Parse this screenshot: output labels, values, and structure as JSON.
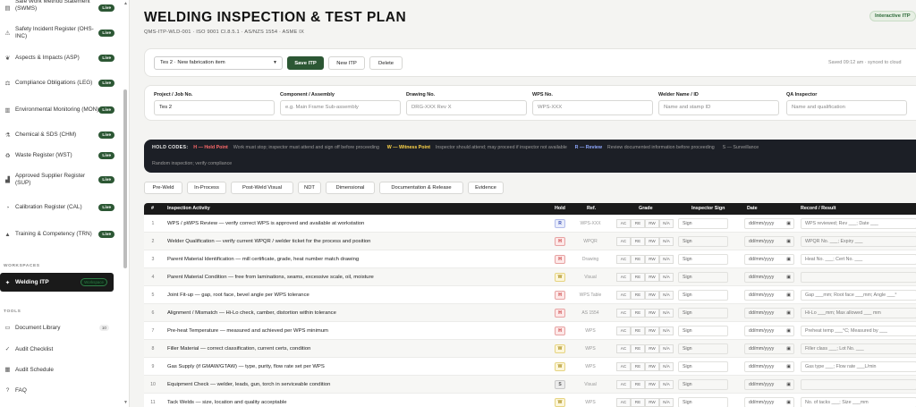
{
  "sidebar": {
    "items": [
      {
        "label": "Safe Work Method Statement (SWMS)",
        "status": "Live",
        "icon": "document-icon"
      },
      {
        "label": "Safety Incident Register (OHS-INC)",
        "status": "Live",
        "icon": "alert-icon"
      },
      {
        "label": "Aspects & Impacts (ASP)",
        "status": "Live",
        "icon": "leaf-icon"
      },
      {
        "label": "Compliance Obligations (LEG)",
        "status": "Live",
        "icon": "scale-icon"
      },
      {
        "label": "Environmental Monitoring (MON)",
        "status": "Live",
        "icon": "chart-icon"
      },
      {
        "label": "Chemical & SDS (CHM)",
        "status": "Live",
        "icon": "flask-icon"
      },
      {
        "label": "Waste Register (WST)",
        "status": "Live",
        "icon": "recycle-icon"
      },
      {
        "label": "Approved Supplier Register (SUP)",
        "status": "Live",
        "icon": "factory-icon"
      },
      {
        "label": "Calibration Register (CAL)",
        "status": "Live",
        "icon": "gauge-icon"
      },
      {
        "label": "Training & Competency (TRN)",
        "status": "Live",
        "icon": "graduation-icon"
      }
    ],
    "workspaces_label": "WORKSPACES",
    "active": {
      "label": "Welding ITP",
      "badge": "Workspace"
    },
    "tools_label": "TOOLS",
    "tools": [
      {
        "label": "Document Library",
        "count": "10",
        "icon": "book-icon"
      },
      {
        "label": "Audit Checklist",
        "icon": "check-icon"
      },
      {
        "label": "Audit Schedule",
        "icon": "calendar-icon"
      },
      {
        "label": "FAQ",
        "icon": "question-icon"
      }
    ]
  },
  "header": {
    "title": "WELDING INSPECTION & TEST PLAN",
    "subtitle": "QMS-ITP-WLD-001 · ISO 9001 Cl.8.5.1 · AS/NZS 1554 · ASME IX",
    "badge": "Interactive ITP"
  },
  "toolbar": {
    "selected_itp": "Tes 2 · New fabrication item",
    "save_label": "Save ITP",
    "new_label": "New ITP",
    "delete_label": "Delete",
    "saved_text": "Saved 09:12 am · synced to cloud"
  },
  "fields": [
    {
      "label": "Project / Job No.",
      "value": "Tes 2",
      "placeholder": ""
    },
    {
      "label": "Component / Assembly",
      "value": "",
      "placeholder": "e.g. Main Frame Sub-assembly"
    },
    {
      "label": "Drawing No.",
      "value": "",
      "placeholder": "DRG-XXX Rev X"
    },
    {
      "label": "WPS No.",
      "value": "",
      "placeholder": "WPS-XXX"
    },
    {
      "label": "Welder Name / ID",
      "value": "",
      "placeholder": "Name and stamp ID"
    },
    {
      "label": "QA Inspector",
      "value": "",
      "placeholder": "Name and qualification"
    }
  ],
  "hold_codes": {
    "heading": "HOLD CODES:",
    "hold_label": "H — Hold Point",
    "hold_desc": "Work must stop; inspector must attend and sign off before proceeding",
    "witness_label": "W — Witness Point",
    "witness_desc": "Inspector should attend; may proceed if inspector not available",
    "review_label": "R — Review",
    "review_desc": "Review documented information before proceeding",
    "surv_label": "S — Surveillance",
    "surv_desc": "Random inspection; verify compliance"
  },
  "filters": [
    "Pre-Weld",
    "In-Process",
    "Post-Weld Visual",
    "NDT",
    "Dimensional",
    "Documentation & Release",
    "Evidence"
  ],
  "table": {
    "headers": {
      "num": "#",
      "activity": "Inspection Activity",
      "hold": "Hold",
      "ref": "Ref.",
      "grade": "Grade",
      "sign": "Inspector Sign",
      "date": "Date",
      "record": "Record / Result"
    },
    "grade_options": [
      "AC",
      "RE",
      "RW",
      "N/A"
    ],
    "sign_placeholder": "Sign",
    "date_placeholder": "dd/mm/yyyy",
    "rows": [
      {
        "num": "1",
        "activity": "WPS / pWPS Review — verify correct WPS is approved and available at workstation",
        "hold": "R",
        "ref": "WPS-XXX",
        "record": "WPS reviewed; Rev ___; Date ___"
      },
      {
        "num": "2",
        "activity": "Welder Qualification — verify current WPQR / welder ticket for the process and position",
        "hold": "H",
        "ref": "WPQR",
        "record": "WPQR No. ___; Expiry ___"
      },
      {
        "num": "3",
        "activity": "Parent Material Identification — mill certificate, grade, heat number match drawing",
        "hold": "H",
        "ref": "Drawing",
        "record": "Heat No. ___; Cert No. ___"
      },
      {
        "num": "4",
        "activity": "Parent Material Condition — free from laminations, seams, excessive scale, oil, moisture",
        "hold": "W",
        "ref": "Visual",
        "record": ""
      },
      {
        "num": "5",
        "activity": "Joint Fit-up — gap, root face, bevel angle per WPS tolerance",
        "hold": "H",
        "ref": "WPS Table",
        "record": "Gap ___mm; Root face ___mm; Angle ___°"
      },
      {
        "num": "6",
        "activity": "Alignment / Mismatch — Hi-Lo check, camber, distortion within tolerance",
        "hold": "H",
        "ref": "AS 1554",
        "record": "Hi-Lo ___mm; Max allowed ___ mm"
      },
      {
        "num": "7",
        "activity": "Pre-heat Temperature — measured and achieved per WPS minimum",
        "hold": "H",
        "ref": "WPS",
        "record": "Preheat temp ___°C; Measured by ___"
      },
      {
        "num": "8",
        "activity": "Filler Material — correct classification, current certs, condition",
        "hold": "W",
        "ref": "WPS",
        "record": "Filler class ___; Lot No. ___"
      },
      {
        "num": "9",
        "activity": "Gas Supply (if GMAW/GTAW) — type, purity, flow rate set per WPS",
        "hold": "W",
        "ref": "WPS",
        "record": "Gas type ___; Flow rate ___L/min"
      },
      {
        "num": "10",
        "activity": "Equipment Check — welder, leads, gun, torch in serviceable condition",
        "hold": "S",
        "ref": "Visual",
        "record": ""
      },
      {
        "num": "11",
        "activity": "Tack Welds — size, location and quality acceptable",
        "hold": "W",
        "ref": "WPS",
        "record": "No. of tacks ___; Size ___mm"
      }
    ]
  }
}
